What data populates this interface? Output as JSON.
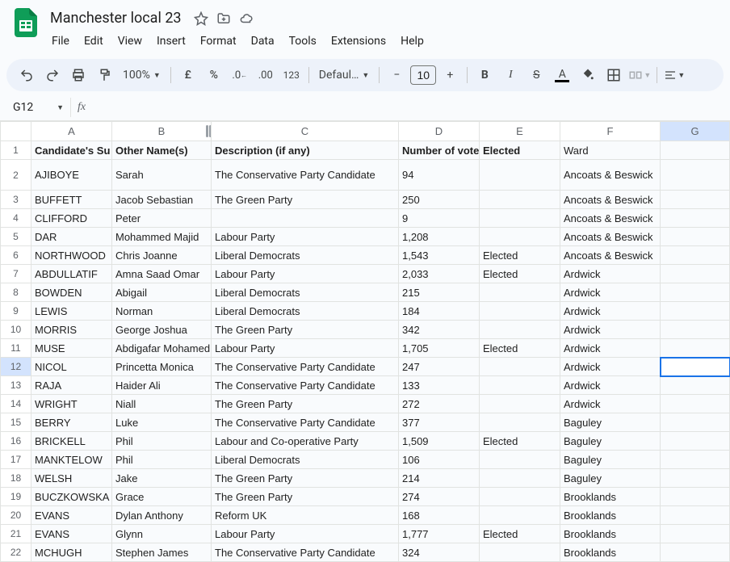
{
  "doc": {
    "title": "Manchester local 23"
  },
  "menu": [
    "File",
    "Edit",
    "View",
    "Insert",
    "Format",
    "Data",
    "Tools",
    "Extensions",
    "Help"
  ],
  "toolbar": {
    "zoom": "100%",
    "font": "Defaul…",
    "fontSize": "10"
  },
  "nameBox": "G12",
  "columns": [
    "A",
    "B",
    "C",
    "D",
    "E",
    "F",
    "G"
  ],
  "selectedCol": "G",
  "selectedRow": 12,
  "headers": {
    "A": "Candidate's Surname",
    "B": "Other Name(s)",
    "C": "Description (if any)",
    "D": "Number of votes",
    "E": "Elected",
    "F": "Ward"
  },
  "chart_data": {
    "type": "table",
    "title": "Manchester local 23",
    "columns": [
      "Candidate's Surname",
      "Other Name(s)",
      "Description (if any)",
      "Number of votes",
      "Elected",
      "Ward"
    ],
    "rows": [
      [
        "AJIBOYE",
        "Sarah",
        "The Conservative Party Candidate",
        94,
        "",
        "Ancoats & Beswick"
      ],
      [
        "BUFFETT",
        "Jacob Sebastian",
        "The Green Party",
        250,
        "",
        "Ancoats & Beswick"
      ],
      [
        "CLIFFORD",
        "Peter",
        "",
        9,
        "",
        "Ancoats & Beswick"
      ],
      [
        "DAR",
        "Mohammed Majid",
        "Labour Party",
        1208,
        "",
        "Ancoats & Beswick"
      ],
      [
        "NORTHWOOD",
        "Chris Joanne",
        "Liberal Democrats",
        1543,
        "Elected",
        "Ancoats & Beswick"
      ],
      [
        "ABDULLATIF",
        "Amna Saad Omar",
        "Labour Party",
        2033,
        "Elected",
        "Ardwick"
      ],
      [
        "BOWDEN",
        "Abigail",
        "Liberal Democrats",
        215,
        "",
        "Ardwick"
      ],
      [
        "LEWIS",
        "Norman",
        "Liberal Democrats",
        184,
        "",
        "Ardwick"
      ],
      [
        "MORRIS",
        "George Joshua",
        "The Green Party",
        342,
        "",
        "Ardwick"
      ],
      [
        "MUSE",
        "Abdigafar Mohamed",
        "Labour Party",
        1705,
        "Elected",
        "Ardwick"
      ],
      [
        "NICOL",
        "Princetta Monica",
        "The Conservative Party Candidate",
        247,
        "",
        "Ardwick"
      ],
      [
        "RAJA",
        "Haider Ali",
        "The Conservative Party Candidate",
        133,
        "",
        "Ardwick"
      ],
      [
        "WRIGHT",
        "Niall",
        "The Green Party",
        272,
        "",
        "Ardwick"
      ],
      [
        "BERRY",
        "Luke",
        "The Conservative Party Candidate",
        377,
        "",
        "Baguley"
      ],
      [
        "BRICKELL",
        "Phil",
        "Labour and Co-operative Party",
        1509,
        "Elected",
        "Baguley"
      ],
      [
        "MANKTELOW",
        "Phil",
        "Liberal Democrats",
        106,
        "",
        "Baguley"
      ],
      [
        "WELSH",
        "Jake",
        "The Green Party",
        214,
        "",
        "Baguley"
      ],
      [
        "BUCZKOWSKA",
        "Grace",
        "The Green Party",
        274,
        "",
        "Brooklands"
      ],
      [
        "EVANS",
        "Dylan Anthony",
        "Reform UK",
        168,
        "",
        "Brooklands"
      ],
      [
        "EVANS",
        "Glynn",
        "Labour Party",
        1777,
        "Elected",
        "Brooklands"
      ],
      [
        "MCHUGH",
        "Stephen James",
        "The Conservative Party Candidate",
        324,
        "",
        "Brooklands"
      ]
    ]
  },
  "displayRows": [
    {
      "n": 2,
      "A": "AJIBOYE",
      "B": "Sarah",
      "C": "The Conservative Party Candidate",
      "D": "94",
      "E": "",
      "F": "Ancoats & Beswick",
      "wrap": true
    },
    {
      "n": 3,
      "A": "BUFFETT",
      "B": "Jacob Sebastian",
      "C": "The Green Party",
      "D": "250",
      "E": "",
      "F": "Ancoats & Beswick"
    },
    {
      "n": 4,
      "A": "CLIFFORD",
      "B": "Peter",
      "C": "",
      "D": "9",
      "E": "",
      "F": "Ancoats & Beswick"
    },
    {
      "n": 5,
      "A": "DAR",
      "B": "Mohammed Majid",
      "C": "Labour Party",
      "D": "1,208",
      "E": "",
      "F": "Ancoats & Beswick"
    },
    {
      "n": 6,
      "A": "NORTHWOOD",
      "B": "Chris Joanne",
      "C": "Liberal Democrats",
      "D": "1,543",
      "E": "Elected",
      "F": "Ancoats & Beswick"
    },
    {
      "n": 7,
      "A": "ABDULLATIF",
      "B": "Amna Saad Omar",
      "C": "Labour Party",
      "D": "2,033",
      "E": "Elected",
      "F": "Ardwick"
    },
    {
      "n": 8,
      "A": "BOWDEN",
      "B": "Abigail",
      "C": "Liberal Democrats",
      "D": "215",
      "E": "",
      "F": "Ardwick"
    },
    {
      "n": 9,
      "A": "LEWIS",
      "B": "Norman",
      "C": "Liberal Democrats",
      "D": "184",
      "E": "",
      "F": "Ardwick"
    },
    {
      "n": 10,
      "A": "MORRIS",
      "B": "George Joshua",
      "C": "The Green Party",
      "D": "342",
      "E": "",
      "F": "Ardwick"
    },
    {
      "n": 11,
      "A": "MUSE",
      "B": "Abdigafar Mohamed",
      "C": "Labour Party",
      "D": "1,705",
      "E": "Elected",
      "F": "Ardwick"
    },
    {
      "n": 12,
      "A": "NICOL",
      "B": "Princetta Monica",
      "C": "The Conservative Party Candidate",
      "D": "247",
      "E": "",
      "F": "Ardwick"
    },
    {
      "n": 13,
      "A": "RAJA",
      "B": "Haider Ali",
      "C": "The Conservative Party Candidate",
      "D": "133",
      "E": "",
      "F": "Ardwick"
    },
    {
      "n": 14,
      "A": "WRIGHT",
      "B": "Niall",
      "C": "The Green Party",
      "D": "272",
      "E": "",
      "F": "Ardwick"
    },
    {
      "n": 15,
      "A": "BERRY",
      "B": "Luke",
      "C": "The Conservative Party Candidate",
      "D": "377",
      "E": "",
      "F": "Baguley"
    },
    {
      "n": 16,
      "A": "BRICKELL",
      "B": "Phil",
      "C": "Labour and Co-operative Party",
      "D": "1,509",
      "E": "Elected",
      "F": "Baguley"
    },
    {
      "n": 17,
      "A": "MANKTELOW",
      "B": "Phil",
      "C": "Liberal Democrats",
      "D": "106",
      "E": "",
      "F": "Baguley"
    },
    {
      "n": 18,
      "A": "WELSH",
      "B": "Jake",
      "C": "The Green Party",
      "D": "214",
      "E": "",
      "F": "Baguley"
    },
    {
      "n": 19,
      "A": "BUCZKOWSKA",
      "B": "Grace",
      "C": "The Green Party",
      "D": "274",
      "E": "",
      "F": "Brooklands"
    },
    {
      "n": 20,
      "A": "EVANS",
      "B": "Dylan Anthony",
      "C": "Reform UK",
      "D": "168",
      "E": "",
      "F": "Brooklands"
    },
    {
      "n": 21,
      "A": "EVANS",
      "B": "Glynn",
      "C": "Labour Party",
      "D": "1,777",
      "E": "Elected",
      "F": "Brooklands"
    },
    {
      "n": 22,
      "A": "MCHUGH",
      "B": "Stephen James",
      "C": "The Conservative Party Candidate",
      "D": "324",
      "E": "",
      "F": "Brooklands"
    }
  ]
}
